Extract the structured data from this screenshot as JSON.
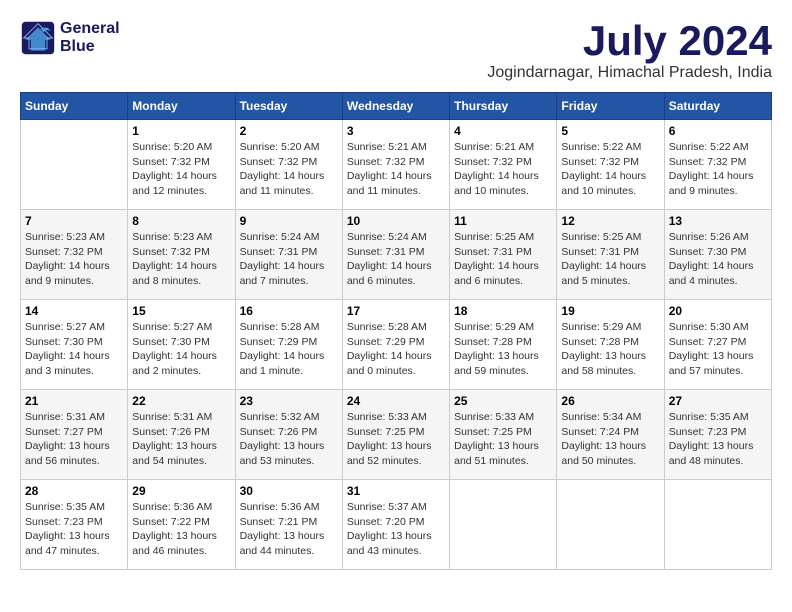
{
  "logo": {
    "line1": "General",
    "line2": "Blue"
  },
  "title": "July 2024",
  "location": "Jogindarnagar, Himachal Pradesh, India",
  "days_header": [
    "Sunday",
    "Monday",
    "Tuesday",
    "Wednesday",
    "Thursday",
    "Friday",
    "Saturday"
  ],
  "weeks": [
    [
      {
        "num": "",
        "info": ""
      },
      {
        "num": "1",
        "info": "Sunrise: 5:20 AM\nSunset: 7:32 PM\nDaylight: 14 hours\nand 12 minutes."
      },
      {
        "num": "2",
        "info": "Sunrise: 5:20 AM\nSunset: 7:32 PM\nDaylight: 14 hours\nand 11 minutes."
      },
      {
        "num": "3",
        "info": "Sunrise: 5:21 AM\nSunset: 7:32 PM\nDaylight: 14 hours\nand 11 minutes."
      },
      {
        "num": "4",
        "info": "Sunrise: 5:21 AM\nSunset: 7:32 PM\nDaylight: 14 hours\nand 10 minutes."
      },
      {
        "num": "5",
        "info": "Sunrise: 5:22 AM\nSunset: 7:32 PM\nDaylight: 14 hours\nand 10 minutes."
      },
      {
        "num": "6",
        "info": "Sunrise: 5:22 AM\nSunset: 7:32 PM\nDaylight: 14 hours\nand 9 minutes."
      }
    ],
    [
      {
        "num": "7",
        "info": "Sunrise: 5:23 AM\nSunset: 7:32 PM\nDaylight: 14 hours\nand 9 minutes."
      },
      {
        "num": "8",
        "info": "Sunrise: 5:23 AM\nSunset: 7:32 PM\nDaylight: 14 hours\nand 8 minutes."
      },
      {
        "num": "9",
        "info": "Sunrise: 5:24 AM\nSunset: 7:31 PM\nDaylight: 14 hours\nand 7 minutes."
      },
      {
        "num": "10",
        "info": "Sunrise: 5:24 AM\nSunset: 7:31 PM\nDaylight: 14 hours\nand 6 minutes."
      },
      {
        "num": "11",
        "info": "Sunrise: 5:25 AM\nSunset: 7:31 PM\nDaylight: 14 hours\nand 6 minutes."
      },
      {
        "num": "12",
        "info": "Sunrise: 5:25 AM\nSunset: 7:31 PM\nDaylight: 14 hours\nand 5 minutes."
      },
      {
        "num": "13",
        "info": "Sunrise: 5:26 AM\nSunset: 7:30 PM\nDaylight: 14 hours\nand 4 minutes."
      }
    ],
    [
      {
        "num": "14",
        "info": "Sunrise: 5:27 AM\nSunset: 7:30 PM\nDaylight: 14 hours\nand 3 minutes."
      },
      {
        "num": "15",
        "info": "Sunrise: 5:27 AM\nSunset: 7:30 PM\nDaylight: 14 hours\nand 2 minutes."
      },
      {
        "num": "16",
        "info": "Sunrise: 5:28 AM\nSunset: 7:29 PM\nDaylight: 14 hours\nand 1 minute."
      },
      {
        "num": "17",
        "info": "Sunrise: 5:28 AM\nSunset: 7:29 PM\nDaylight: 14 hours\nand 0 minutes."
      },
      {
        "num": "18",
        "info": "Sunrise: 5:29 AM\nSunset: 7:28 PM\nDaylight: 13 hours\nand 59 minutes."
      },
      {
        "num": "19",
        "info": "Sunrise: 5:29 AM\nSunset: 7:28 PM\nDaylight: 13 hours\nand 58 minutes."
      },
      {
        "num": "20",
        "info": "Sunrise: 5:30 AM\nSunset: 7:27 PM\nDaylight: 13 hours\nand 57 minutes."
      }
    ],
    [
      {
        "num": "21",
        "info": "Sunrise: 5:31 AM\nSunset: 7:27 PM\nDaylight: 13 hours\nand 56 minutes."
      },
      {
        "num": "22",
        "info": "Sunrise: 5:31 AM\nSunset: 7:26 PM\nDaylight: 13 hours\nand 54 minutes."
      },
      {
        "num": "23",
        "info": "Sunrise: 5:32 AM\nSunset: 7:26 PM\nDaylight: 13 hours\nand 53 minutes."
      },
      {
        "num": "24",
        "info": "Sunrise: 5:33 AM\nSunset: 7:25 PM\nDaylight: 13 hours\nand 52 minutes."
      },
      {
        "num": "25",
        "info": "Sunrise: 5:33 AM\nSunset: 7:25 PM\nDaylight: 13 hours\nand 51 minutes."
      },
      {
        "num": "26",
        "info": "Sunrise: 5:34 AM\nSunset: 7:24 PM\nDaylight: 13 hours\nand 50 minutes."
      },
      {
        "num": "27",
        "info": "Sunrise: 5:35 AM\nSunset: 7:23 PM\nDaylight: 13 hours\nand 48 minutes."
      }
    ],
    [
      {
        "num": "28",
        "info": "Sunrise: 5:35 AM\nSunset: 7:23 PM\nDaylight: 13 hours\nand 47 minutes."
      },
      {
        "num": "29",
        "info": "Sunrise: 5:36 AM\nSunset: 7:22 PM\nDaylight: 13 hours\nand 46 minutes."
      },
      {
        "num": "30",
        "info": "Sunrise: 5:36 AM\nSunset: 7:21 PM\nDaylight: 13 hours\nand 44 minutes."
      },
      {
        "num": "31",
        "info": "Sunrise: 5:37 AM\nSunset: 7:20 PM\nDaylight: 13 hours\nand 43 minutes."
      },
      {
        "num": "",
        "info": ""
      },
      {
        "num": "",
        "info": ""
      },
      {
        "num": "",
        "info": ""
      }
    ]
  ]
}
